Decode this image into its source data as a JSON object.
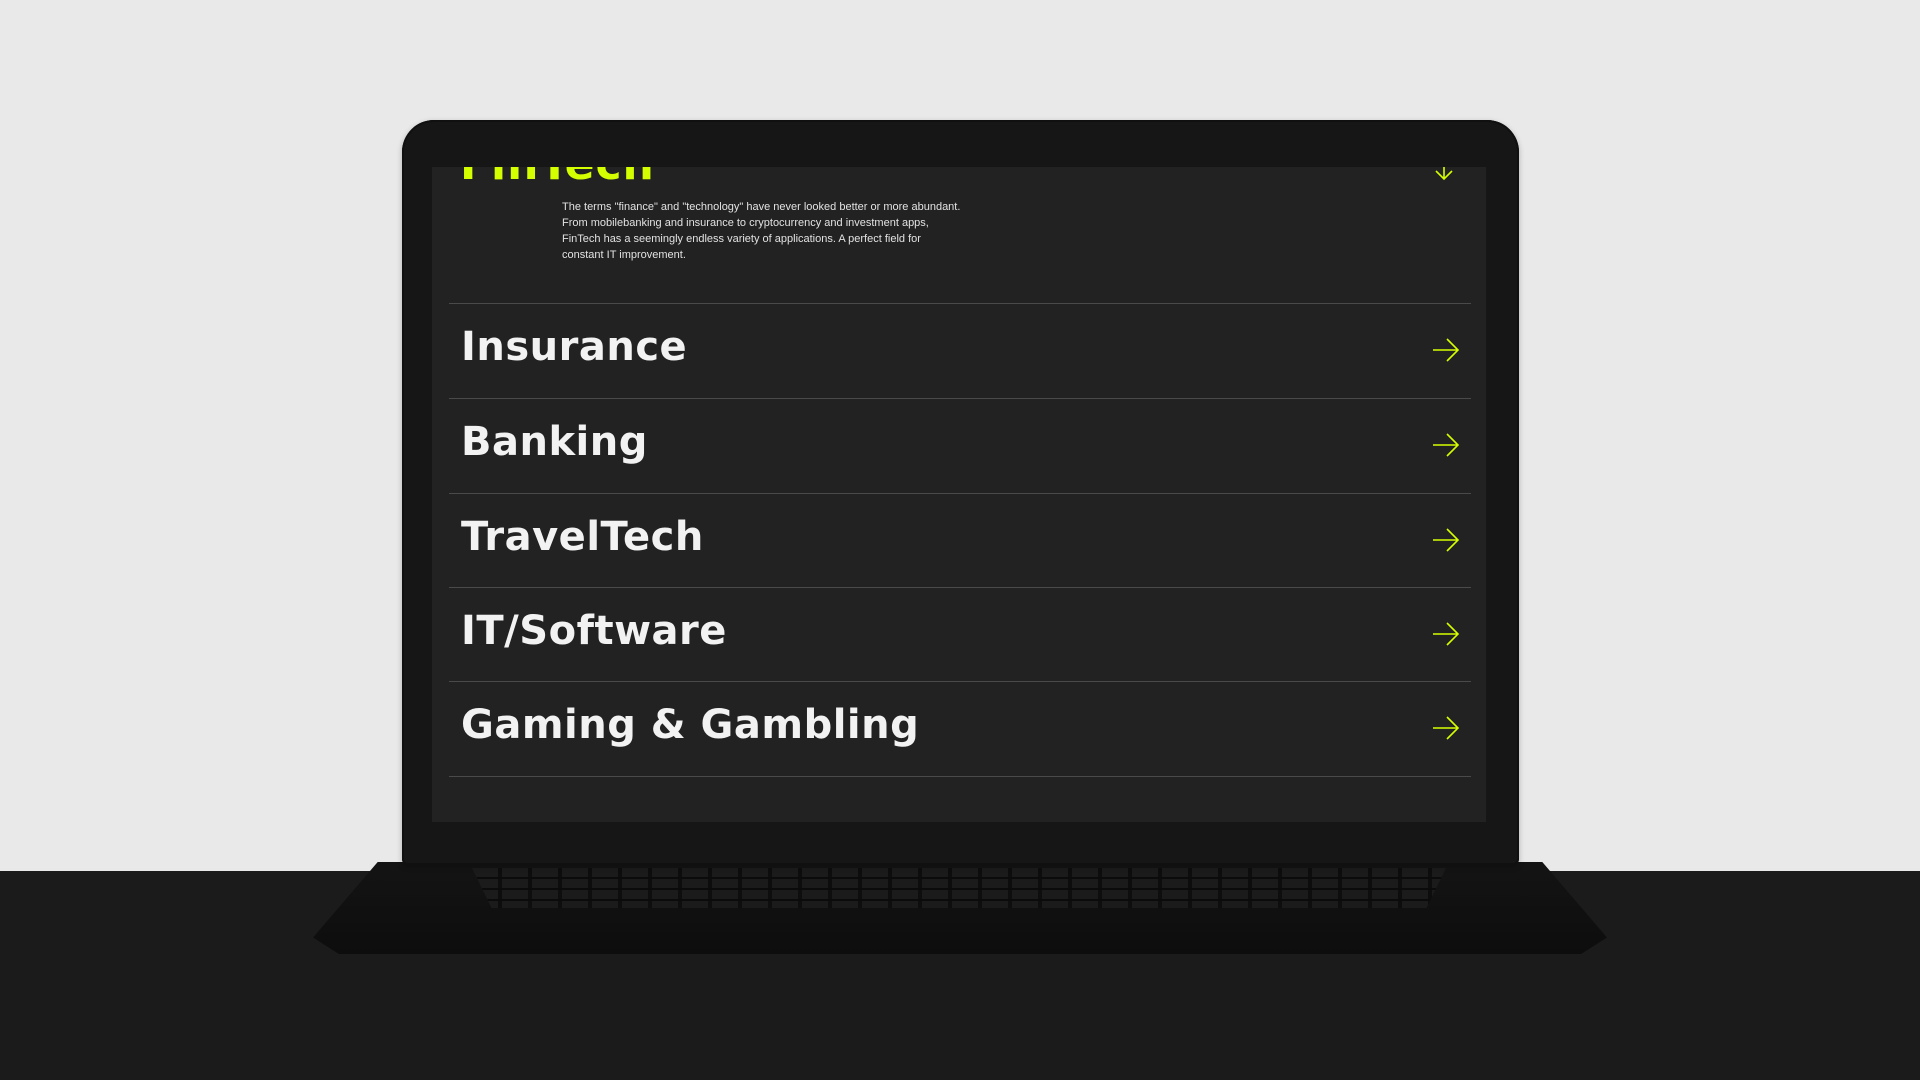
{
  "colors": {
    "accent": "#d4ff00",
    "screen_background": "#222222",
    "divider": "#4a4a4a",
    "backdrop": "#e9e9e9"
  },
  "expanded_section": {
    "title": "FinTech",
    "description": "The terms \"finance\" and \"technology\" have never looked better or more abundant. From mobilebanking and insurance to cryptocurrency and investment apps, FinTech has a seemingly endless variety of applications. A perfect field for constant IT improvement.",
    "icon": "arrow-down-icon"
  },
  "industries": [
    {
      "label": "Insurance",
      "icon": "arrow-right-icon"
    },
    {
      "label": "Banking",
      "icon": "arrow-right-icon"
    },
    {
      "label": "TravelTech",
      "icon": "arrow-right-icon"
    },
    {
      "label": "IT/Software",
      "icon": "arrow-right-icon"
    },
    {
      "label": "Gaming & Gambling",
      "icon": "arrow-right-icon"
    }
  ]
}
